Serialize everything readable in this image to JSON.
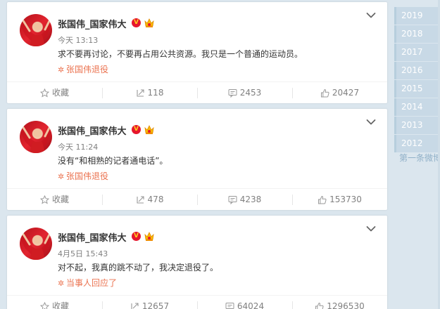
{
  "posts": [
    {
      "author": "张国伟_国家伟大",
      "time": "今天 13:13",
      "text": "求不要再讨论，不要再占用公共资源。我只是一个普通的运动员。",
      "tag": "张国伟退役",
      "actions": {
        "favorite": "收藏",
        "repost": "118",
        "comment": "2453",
        "like": "20427"
      }
    },
    {
      "author": "张国伟_国家伟大",
      "time": "今天 11:24",
      "text": "没有“和相熟的记者通电话”。",
      "tag": "张国伟退役",
      "actions": {
        "favorite": "收藏",
        "repost": "478",
        "comment": "4238",
        "like": "153730"
      }
    },
    {
      "author": "张国伟_国家伟大",
      "time": "4月5日 15:43",
      "text": "对不起，我真的跳不动了，我决定退役了。",
      "tag": "当事人回应了",
      "actions": {
        "favorite": "收藏",
        "repost": "12657",
        "comment": "64024",
        "like": "1296530"
      }
    }
  ],
  "timeline": {
    "years": [
      "2019",
      "2018",
      "2017",
      "2016",
      "2015",
      "2014",
      "2013",
      "2012"
    ],
    "more": "第一条微博"
  },
  "colors": {
    "accent": "#eb7350",
    "verified": "#e6162d",
    "background": "#dbe6ee"
  },
  "icons": [
    "chevron-down-icon",
    "star-icon",
    "repost-icon",
    "comment-icon",
    "thumbs-up-icon",
    "verified-badge-icon",
    "crown-icon",
    "topic-icon"
  ]
}
